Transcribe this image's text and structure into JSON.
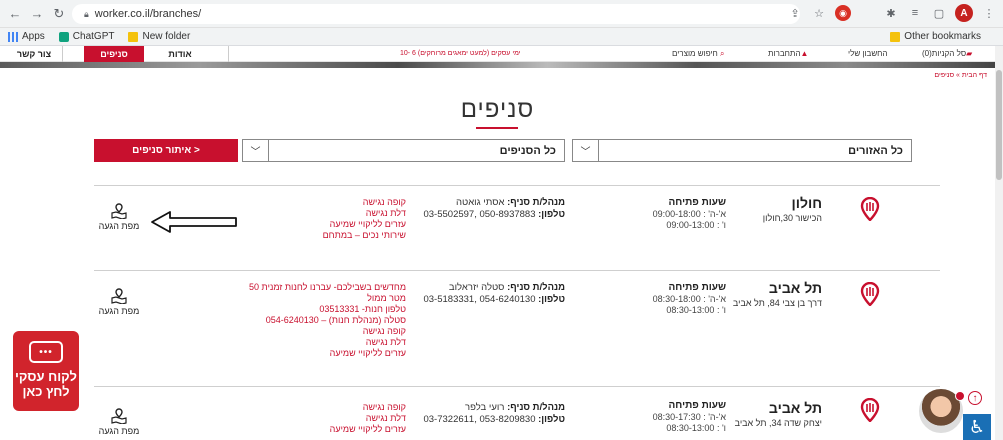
{
  "browser": {
    "url": "worker.co.il/branches/",
    "bookmarks": [
      "Apps",
      "ChatGPT",
      "New folder"
    ],
    "other_bookmarks": "Other bookmarks",
    "avatar_letter": "A"
  },
  "header": {
    "cart": "סל הקניות(0)",
    "account": "החשבון שלי",
    "login": "התחברות",
    "search": "חיפוש מוצרים",
    "promo": "10- 6 ימי עסקים (למעט ימאגים מרוחקים)",
    "tabs": {
      "about": "אודות",
      "branches": "סניפים",
      "contact": "צור קשר"
    }
  },
  "breadcrumb": "דף הבית » סניפים",
  "page": {
    "title": "סניפים"
  },
  "filters": {
    "region": "כל האזורים",
    "branch": "כל הסניפים",
    "find_button": "איתור סניפים >"
  },
  "labels": {
    "hours": "שעות פתיחה",
    "manager": "מנהל/ת סניף:",
    "phone": "טלפון:",
    "map": "מפת הגעה"
  },
  "branches": [
    {
      "city": "חולון",
      "address": "הכישור 30,חולון",
      "hours": [
        "א'-ה' : 09:00-18:00",
        "ו' : 09:00-13:00"
      ],
      "manager": "אסתי גואטה",
      "phones": "050-8937883 ,03-5502597",
      "services": [
        "קופה נגישה",
        "דלת נגישה",
        "עזרים לליקויי שמיעה",
        "שירותי נכים – במתחם"
      ]
    },
    {
      "city": "תל אביב",
      "address": "דרך בן צבי 84, תל אביב",
      "hours": [
        "א'-ה' : 08:30-18:00",
        "ו' : 08:30-13:00"
      ],
      "manager": "סטלה יזראלוב",
      "phones": "054-6240130 ,03-5183331",
      "services": [
        "מחדשים בשבילכם- עברנו לחנות זמנית 50",
        "מטר ממול",
        "טלפון חנות- 03513331",
        "סטלה (מנהלת חנות) – 054-6240130",
        "קופה נגישה",
        "דלת נגישה",
        "עזרים לליקויי שמיעה"
      ]
    },
    {
      "city": "תל אביב",
      "address": "יצחק שדה 34, תל אביב",
      "hours": [
        "א'-ה' : 08:30-17:30",
        "ו' : 08:30-13:00"
      ],
      "manager": "רועי בלפר",
      "phones": "053-8209830 ,03-7322611",
      "services": [
        "קופה נגישה",
        "דלת נגישה",
        "עזרים לליקויי שמיעה"
      ]
    }
  ],
  "chat_widget": {
    "line1": "לקוח עסקי",
    "line2": "לחץ כאן",
    "dots": "•••"
  },
  "colors": {
    "brand_red": "#c8102e",
    "accessibility_blue": "#1a6fb5"
  }
}
